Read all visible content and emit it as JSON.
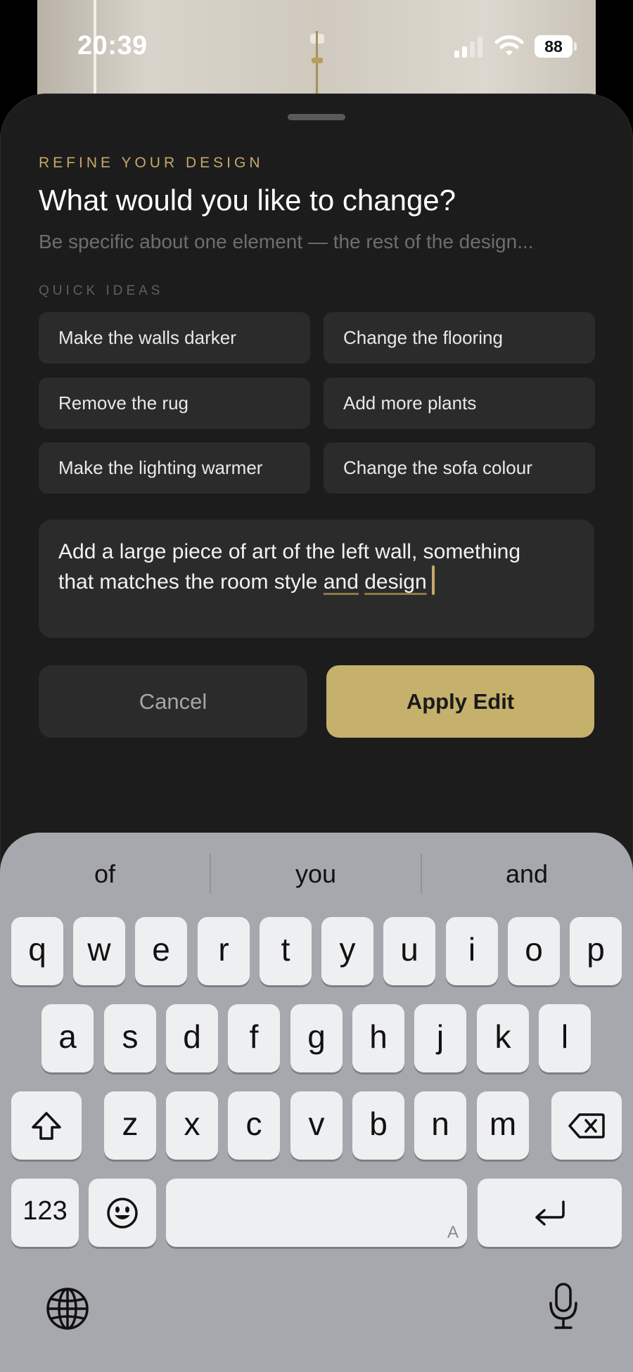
{
  "status_bar": {
    "time": "20:39",
    "battery_level": "88",
    "signal_bars_active": 2,
    "signal_bars_total": 4
  },
  "sheet": {
    "eyebrow": "REFINE YOUR DESIGN",
    "title": "What would you like to change?",
    "subtitle": "Be specific about one element — the rest of the design...",
    "quick_ideas_label": "QUICK IDEAS",
    "quick_ideas": [
      "Make the walls darker",
      "Change the flooring",
      "Remove the rug",
      "Add more plants",
      "Make the lighting warmer",
      "Change the sofa colour"
    ],
    "input": {
      "line1": "Add a large piece of art of the left wall, something",
      "line2_prefix": "that matches the room style ",
      "line2_word1": "and",
      "line2_word2": "design"
    },
    "cancel_label": "Cancel",
    "apply_label": "Apply Edit"
  },
  "keyboard": {
    "predictions": [
      "of",
      "you",
      "and"
    ],
    "row1": [
      "q",
      "w",
      "e",
      "r",
      "t",
      "y",
      "u",
      "i",
      "o",
      "p"
    ],
    "row2": [
      "a",
      "s",
      "d",
      "f",
      "g",
      "h",
      "j",
      "k",
      "l"
    ],
    "row3": [
      "z",
      "x",
      "c",
      "v",
      "b",
      "n",
      "m"
    ],
    "numbers_label": "123",
    "space_hint": "A"
  },
  "colors": {
    "accent_gold": "#c5b06c",
    "eyebrow_gold": "#c6a867",
    "sheet_background": "#1c1c1c",
    "chip_background": "#2b2b2b",
    "keyboard_background": "#a6a8ad"
  },
  "icons": {
    "signal": "cellular-signal-icon",
    "wifi": "wifi-icon",
    "battery": "battery-icon",
    "shift": "shift-icon",
    "backspace": "backspace-icon",
    "emoji": "emoji-icon",
    "return": "return-icon",
    "globe": "globe-icon",
    "microphone": "microphone-icon"
  }
}
